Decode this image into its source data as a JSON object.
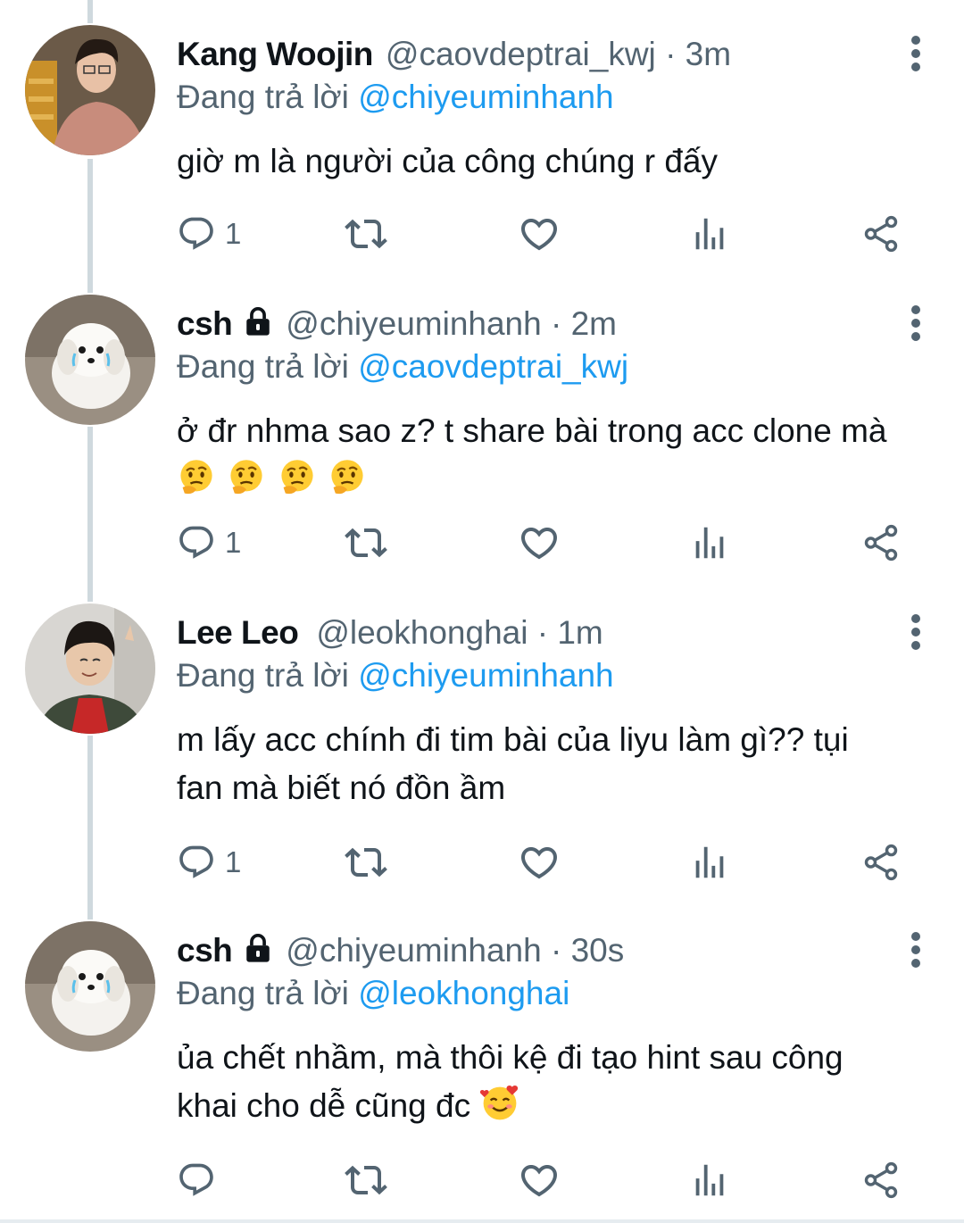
{
  "colors": {
    "link": "#1d9bf0",
    "muted": "#536471",
    "text": "#0f1419",
    "thread_line": "#cfd9de"
  },
  "reply_prefix": "Đang trả lời",
  "tweets": [
    {
      "name": "Kang Woojin",
      "handle": "@caovdeptrai_kwj",
      "sep": "·",
      "time": "3m",
      "locked": false,
      "reply_to": "@chiyeuminhanh",
      "text": "giờ m là người của công chúng r đấy",
      "reply_count": "1",
      "avatar": "man-in-sweater-photo"
    },
    {
      "name": "csh",
      "handle": "@chiyeuminhanh",
      "sep": "·",
      "time": "2m",
      "locked": true,
      "reply_to": "@caovdeptrai_kwj",
      "text": "ở đr nhma sao z? t share bài trong acc clone mà",
      "emoji": [
        "thinking-face",
        "thinking-face",
        "thinking-face",
        "thinking-face"
      ],
      "reply_count": "1",
      "avatar": "white-puppy-photo"
    },
    {
      "name": "Lee Leo",
      "handle": "@leokhonghai",
      "sep": "·",
      "time": "1m",
      "locked": false,
      "reply_to": "@chiyeuminhanh",
      "text_line1": "m lấy acc chính đi tim bài của liyu làm gì?? tụi",
      "text_line2": "fan mà biết nó đồn ầm",
      "reply_count": "1",
      "avatar": "young-man-selfie-photo"
    },
    {
      "name": "csh",
      "handle": "@chiyeuminhanh",
      "sep": "·",
      "time": "30s",
      "locked": true,
      "reply_to": "@leokhonghai",
      "text_line1": "ủa chết nhầm, mà thôi kệ đi tạo hint sau công",
      "text_line2": "khai cho dễ cũng đc",
      "emoji": [
        "smiling-face-with-hearts"
      ],
      "reply_count": "",
      "avatar": "white-puppy-photo"
    }
  ]
}
